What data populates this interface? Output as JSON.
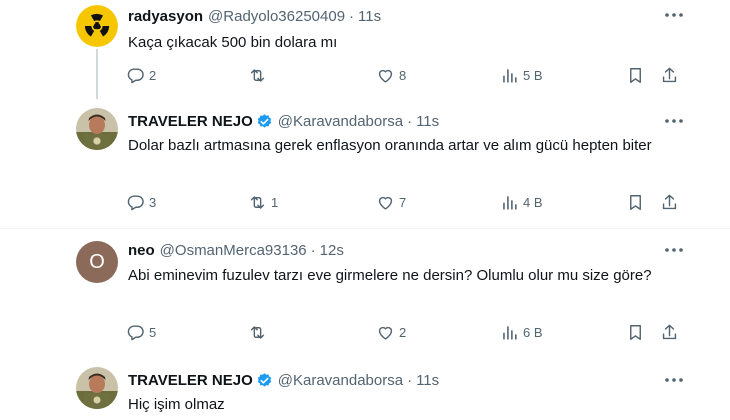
{
  "tweets": [
    {
      "name": "radyasyon",
      "handle": "@Radyolo36250409",
      "dot": "·",
      "time": "11s",
      "text": "Kaça çıkacak 500 bin dolara mı",
      "replies": "2",
      "retweets": "",
      "likes": "8",
      "views": "5 B",
      "avatar": "radiation-symbol"
    },
    {
      "name": "TRAVELER NEJO",
      "handle": "@Karavandaborsa",
      "dot": "·",
      "time": "11s",
      "text": "Dolar bazlı artmasına gerek enflasyon oranında artar ve alım gücü hepten biter",
      "replies": "3",
      "retweets": "1",
      "likes": "7",
      "views": "4 B",
      "avatar": "profile-photo"
    },
    {
      "name": "neo",
      "handle": "@OsmanMerca93136",
      "dot": "·",
      "time": "12s",
      "text": "Abi eminevim fuzulev tarzı eve girmelere ne dersin? Olumlu olur mu size göre?",
      "replies": "5",
      "retweets": "",
      "likes": "2",
      "views": "6 B",
      "avatar_letter": "O",
      "avatar_color": "#8b6a5a"
    },
    {
      "name": "TRAVELER NEJO",
      "handle": "@Karavandaborsa",
      "dot": "·",
      "time": "11s",
      "text": "Hiç işim olmaz",
      "avatar": "profile-photo"
    }
  ],
  "colors": {
    "verified": "#1d9bf0",
    "muted": "#536471",
    "thread_line": "#cfd9de"
  }
}
